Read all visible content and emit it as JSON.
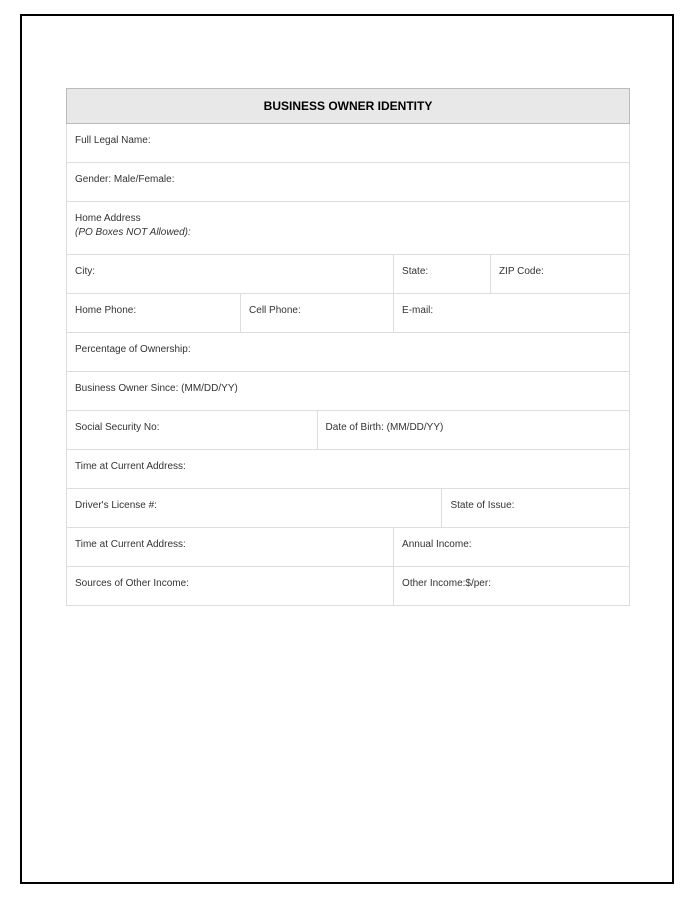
{
  "title": "BUSINESS OWNER IDENTITY",
  "rows": {
    "fullLegalName": "Full Legal Name:",
    "gender": "Gender: Male/Female:",
    "homeAddressLine1": "Home Address",
    "homeAddressLine2": "(PO Boxes NOT Allowed):",
    "city": "City:",
    "state": "State:",
    "zip": "ZIP Code:",
    "homePhone": "Home Phone:",
    "cellPhone": "Cell Phone:",
    "email": "E-mail:",
    "percentageOwnership": "Percentage of Ownership:",
    "businessOwnerSince": "Business Owner Since:   (MM/DD/YY)",
    "ssn": "Social Security No:",
    "dob": "Date of Birth: (MM/DD/YY)",
    "timeAtCurrentAddress1": "Time at Current Address:",
    "driversLicense": "Driver's License #:",
    "stateOfIssue": "State of Issue:",
    "timeAtCurrentAddress2": "Time at Current Address:",
    "annualIncome": "Annual Income:",
    "sourcesOtherIncome": "Sources of Other Income:",
    "otherIncome": "Other Income:$/per:"
  }
}
